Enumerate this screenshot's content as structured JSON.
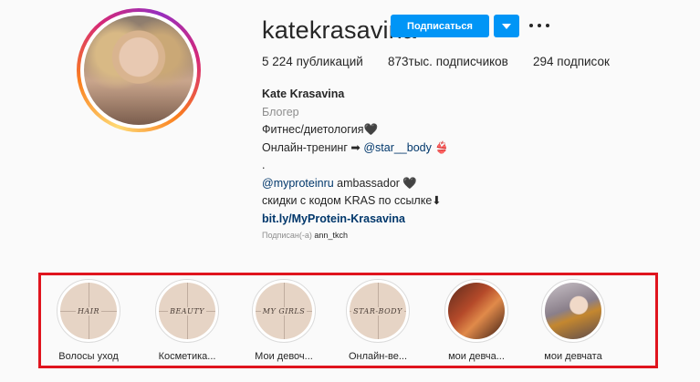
{
  "profile": {
    "username": "katekrasavina",
    "follow_label": "Подписаться",
    "stats": {
      "posts_count": "5 224",
      "posts_label": "публикаций",
      "followers_count": "873тыс.",
      "followers_label": "подписчиков",
      "following_count": "294",
      "following_label": "подписок"
    },
    "bio": {
      "name": "Kate Krasavina",
      "category": "Блогер",
      "line1": "Фитнес/диетология🖤",
      "line2_text": "Онлайн-тренинг ➡ ",
      "line2_link": "@star__body",
      "line2_tail": " 👙",
      "line3": ".",
      "line4_link": "@myproteinru",
      "line4_text": " ambassador 🖤",
      "line5": "скидки с кодом KRAS по ссылке⬇",
      "url": "bit.ly/MyProtein-Krasavina"
    },
    "followed_by_prefix": "Подписан(-а)",
    "followed_by_user": "ann_tkch"
  },
  "highlights": [
    {
      "cover_text": "HAIR",
      "label": "Волосы уход"
    },
    {
      "cover_text": "BEAUTY",
      "label": "Косметика..."
    },
    {
      "cover_text": "MY GIRLS",
      "label": "Мои девоч..."
    },
    {
      "cover_text": "STAR-BODY",
      "label": "Онлайн-ве..."
    },
    {
      "cover_text": "",
      "label": "мои девча..."
    },
    {
      "cover_text": "",
      "label": "мои девчата"
    }
  ],
  "colors": {
    "accent": "#0095f6",
    "highlight_frame": "#e0141e",
    "link": "#00376b"
  }
}
